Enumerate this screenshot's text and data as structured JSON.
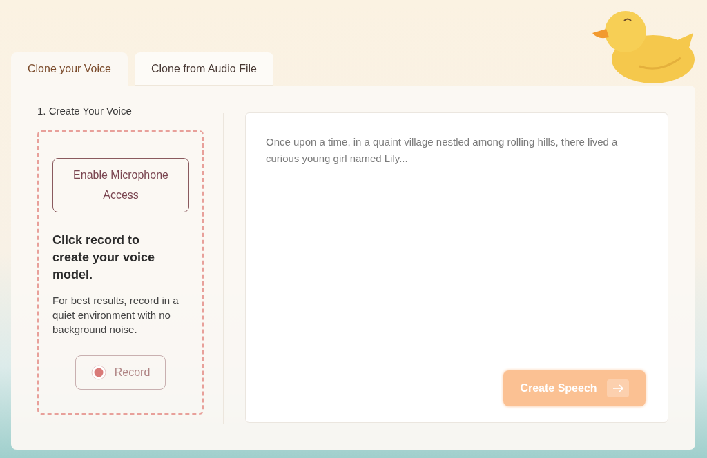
{
  "tabs": [
    {
      "label": "Clone your Voice",
      "selected": true
    },
    {
      "label": "Clone from Audio File",
      "selected": false
    }
  ],
  "left_panel": {
    "step_title": "1. Create Your Voice",
    "mic_button": "Enable Microphone Access",
    "heading": "Click record to create your voice model.",
    "hint": "For best results, record in a quiet environment with no background noise.",
    "record_button": "Record"
  },
  "text_input": {
    "placeholder": "Once upon a time, in a quaint village nestled among rolling hills, there lived a curious young girl named Lily..."
  },
  "create_button": {
    "label": "Create Speech",
    "disabled": true
  }
}
